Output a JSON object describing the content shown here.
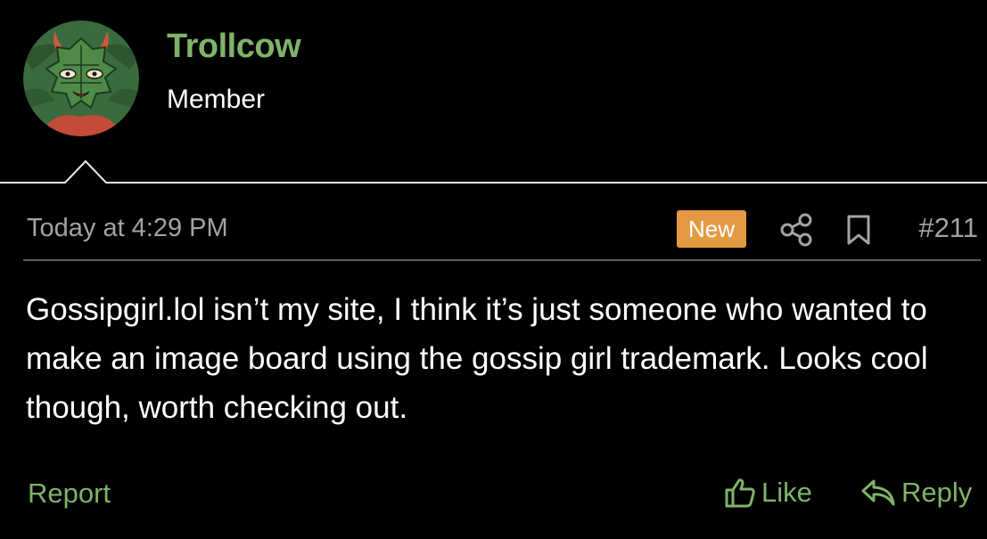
{
  "colors": {
    "background": "#000000",
    "accent_green": "#7fb36a",
    "muted_text": "#a3a3a3",
    "badge_orange": "#e39a42",
    "divider": "#5c5c5c"
  },
  "author": {
    "username": "Trollcow",
    "role": "Member",
    "avatar_icon": "green-face-with-horns-avatar"
  },
  "meta": {
    "timestamp": "Today at 4:29 PM",
    "badge": "New",
    "share_icon": "share-icon",
    "bookmark_icon": "bookmark-icon",
    "post_number": "#211"
  },
  "post": {
    "message": "Gossipgirl.lol isn’t my site, I think it’s just someone who wanted to make an image board using the gossip girl trademark. Looks cool though, worth checking out."
  },
  "actions": {
    "report_label": "Report",
    "like_label": "Like",
    "reply_label": "Reply",
    "like_icon": "thumbs-up-icon",
    "reply_icon": "reply-icon"
  }
}
